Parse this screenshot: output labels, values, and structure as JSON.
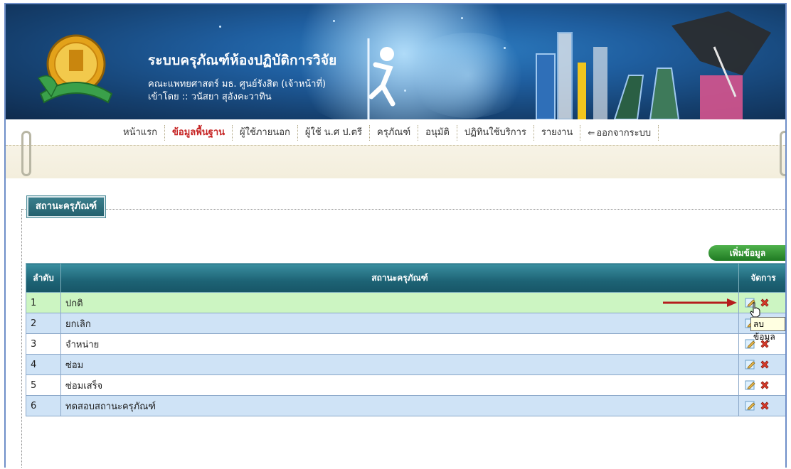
{
  "header": {
    "title": "ระบบครุภัณฑ์ห้องปฏิบัติการวิจัย",
    "faculty": "คณะแพทยศาสตร์ มธ. ศูนย์รังสิต (เจ้าหน้าที่)",
    "login": "เข้าโดย :: วนัสยา สุอังคะวาทิน"
  },
  "menu": {
    "items": [
      {
        "label": "หน้าแรก"
      },
      {
        "label": "ข้อมูลพื้นฐาน"
      },
      {
        "label": "ผู้ใช้ภายนอก"
      },
      {
        "label": "ผู้ใช้ น.ศ ป.ตรี"
      },
      {
        "label": "ครุภัณฑ์"
      },
      {
        "label": "อนุมัติ"
      },
      {
        "label": "ปฏิทินใช้บริการ"
      },
      {
        "label": "รายงาน"
      },
      {
        "label": "ออกจากระบบ"
      }
    ],
    "active_index": 1
  },
  "section": {
    "legend": "สถานะครุภัณฑ์",
    "add_button": "เพิ่มข้อมูล"
  },
  "table": {
    "headers": [
      "ลำดับ",
      "สถานะครุภัณฑ์",
      "จัดการ"
    ],
    "rows": [
      {
        "no": "1",
        "status": "ปกติ"
      },
      {
        "no": "2",
        "status": "ยกเลิก"
      },
      {
        "no": "3",
        "status": "จำหน่าย"
      },
      {
        "no": "4",
        "status": "ซ่อม"
      },
      {
        "no": "5",
        "status": "ซ่อมเสร็จ"
      },
      {
        "no": "6",
        "status": "ทดสอบสถานะครุภัณฑ์"
      }
    ]
  },
  "tooltip": "ลบข้อมูล",
  "icons": {
    "edit": "edit-icon",
    "delete": "delete-icon",
    "logout": "logout-icon",
    "logo": "university-logo",
    "pointer": "hand-cursor-icon",
    "arrow": "red-arrow"
  },
  "colors": {
    "active_menu": "#c62424",
    "header_teal": "#1d6375",
    "row_blue": "#cfe3f6",
    "row_selected": "#ccf5c2",
    "add_green": "#2f9a2f",
    "delete_red": "#d83b2a"
  }
}
